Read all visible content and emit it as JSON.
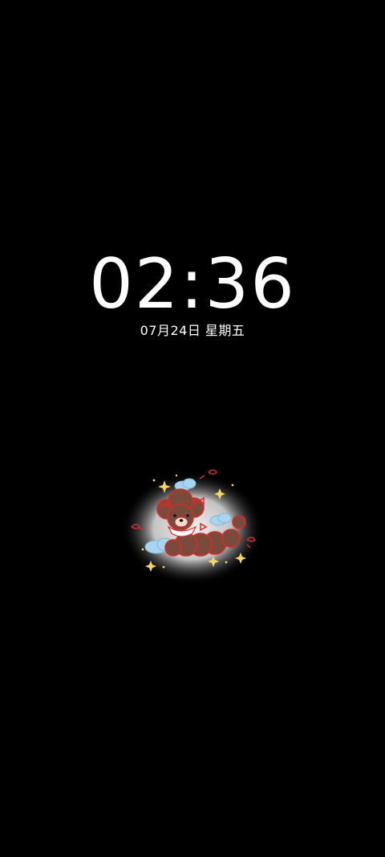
{
  "lockscreen": {
    "time": "02:36",
    "date": "07月24日 星期五"
  },
  "sticker": {
    "icon": "poodle-sticker-icon",
    "colors": {
      "fur": "#7a4a3a",
      "outline": "#d32d2d",
      "cloud": "#a8d4f0",
      "sparkle": "#f3d36a"
    }
  }
}
